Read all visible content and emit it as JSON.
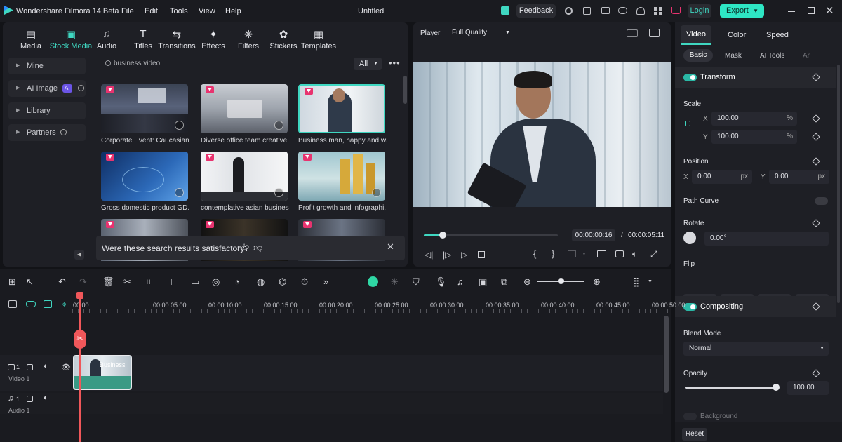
{
  "titlebar": {
    "app_title": "Wondershare Filmora 14 Beta",
    "menu": [
      "File",
      "Edit",
      "Tools",
      "View",
      "Help"
    ],
    "project_title": "Untitled",
    "feedback_label": "Feedback",
    "login_label": "Login",
    "export_label": "Export"
  },
  "library": {
    "tabs": [
      {
        "label": "Media",
        "icon": "media-icon"
      },
      {
        "label": "Stock Media",
        "icon": "stock-media-icon"
      },
      {
        "label": "Audio",
        "icon": "music-note-icon"
      },
      {
        "label": "Titles",
        "icon": "title-icon"
      },
      {
        "label": "Transitions",
        "icon": "transition-icon"
      },
      {
        "label": "Effects",
        "icon": "effects-icon"
      },
      {
        "label": "Filters",
        "icon": "filters-icon"
      },
      {
        "label": "Stickers",
        "icon": "stickers-icon"
      },
      {
        "label": "Templates",
        "icon": "templates-icon"
      }
    ],
    "sidebar": [
      "Mine",
      "AI Image",
      "Library",
      "Partners"
    ],
    "ai_badge": "AI",
    "search_placeholder": "business video",
    "filter_value": "All",
    "results": [
      "Corporate Event: Caucasian ...",
      "Diverse office team creative ...",
      "Business man, happy and w...",
      "Gross domestic product GD...",
      "contemplative asian busines...",
      "Profit growth and infographi..."
    ],
    "feedback_prompt": "Were these search results satisfactory?"
  },
  "player": {
    "label": "Player",
    "quality": "Full Quality",
    "current_time": "00:00:00:16",
    "separator": "/",
    "total_time": "00:00:05:11",
    "progress": 0.14
  },
  "properties": {
    "tabs": [
      "Video",
      "Color",
      "Speed"
    ],
    "subtabs": [
      "Basic",
      "Mask",
      "AI Tools",
      "Ar"
    ],
    "transform_label": "Transform",
    "scale_label": "Scale",
    "scale_x_axis": "X",
    "scale_x": "100.00",
    "scale_y_axis": "Y",
    "scale_y": "100.00",
    "percent_unit": "%",
    "position_label": "Position",
    "pos_x_axis": "X",
    "pos_x": "0.00",
    "pos_y_axis": "Y",
    "pos_y": "0.00",
    "px_unit": "px",
    "path_curve_label": "Path Curve",
    "rotate_label": "Rotate",
    "rotate_value": "0.00°",
    "flip_label": "Flip",
    "compositing_label": "Compositing",
    "blend_mode_label": "Blend Mode",
    "blend_mode_value": "Normal",
    "opacity_label": "Opacity",
    "opacity_value": "100.00",
    "opacity_fraction": 1.0,
    "background_label": "Background",
    "reset_label": "Reset"
  },
  "timeline": {
    "ticks": [
      "00:00",
      "00:00:05:00",
      "00:00:10:00",
      "00:00:15:00",
      "00:00:20:00",
      "00:00:25:00",
      "00:00:30:00",
      "00:00:35:00",
      "00:00:40:00",
      "00:00:45:00",
      "00:00:50:00"
    ],
    "video_track_number": "1",
    "video_track_name": "Video 1",
    "audio_track_number": "1",
    "audio_track_name": "Audio 1",
    "clip_label": "Business",
    "zoom_fraction": 0.5
  },
  "colors": {
    "accent": "#3fd7c1",
    "export": "#2ee6c4",
    "playhead": "#f0575a",
    "clip": "#3a9a85"
  }
}
